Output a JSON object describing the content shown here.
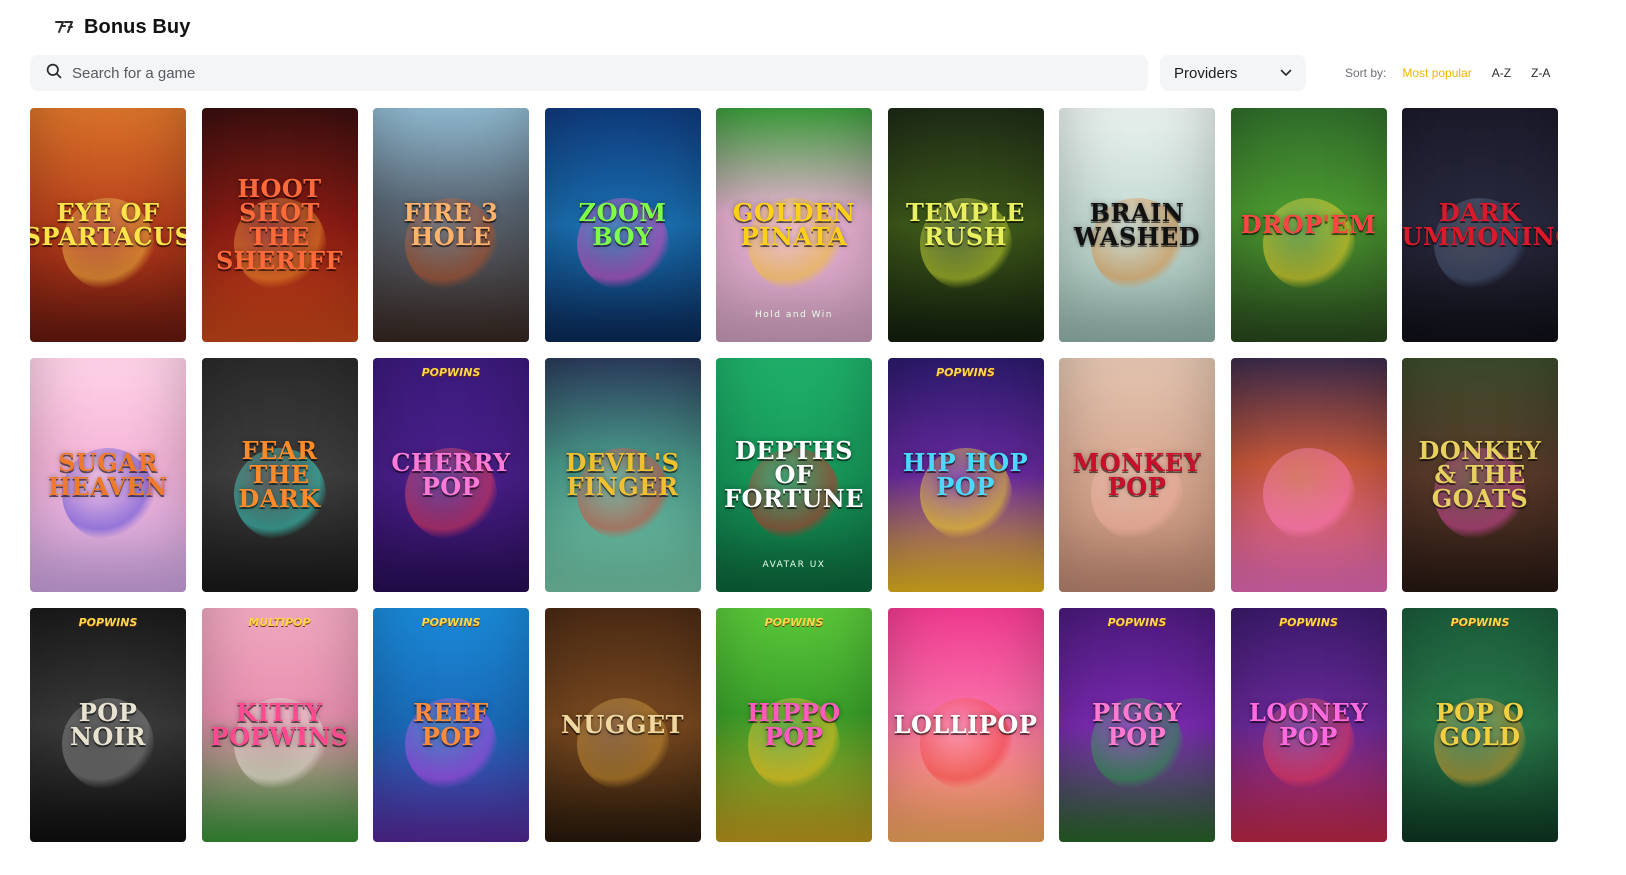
{
  "header": {
    "title": "Bonus Buy",
    "logo_icon": "logo-7-icon"
  },
  "search": {
    "placeholder": "Search for a game"
  },
  "providers": {
    "label": "Providers"
  },
  "sort": {
    "label": "Sort by:",
    "options": [
      "Most popular",
      "A-Z",
      "Z-A"
    ],
    "active": "Most popular",
    "active_color": "#f0b400"
  },
  "games": [
    {
      "slug": "eye-of-spartacus",
      "title": "Eye of Spartacus",
      "bg": "linear-gradient(180deg,#d9732a 0%,#b3391a 55%,#6b1a10 100%)",
      "fg": "#ffe34a",
      "art": "#f2b640"
    },
    {
      "slug": "hoot-shot-the-sheriff",
      "title": "Hoot Shot The Sheriff",
      "bg": "linear-gradient(180deg,#3a0f0f 0%,#8e1c14 50%,#d24a1a 100%)",
      "fg": "#ff6a3a",
      "art": "#e88a2a"
    },
    {
      "slug": "fire-3-hole",
      "title": "Fire 3 Hole",
      "bg": "linear-gradient(180deg,#8fb8cf 0%,#5c6a78 40%,#3a2a24 100%)",
      "fg": "#ffb36a",
      "art": "#b5532a"
    },
    {
      "slug": "zoom-boy",
      "title": "Zoom Boy",
      "bg": "linear-gradient(180deg,#0f3a7a 0%,#1a6fb0 50%,#0b2a5a 100%)",
      "fg": "#7dff4a",
      "art": "#e84ac0"
    },
    {
      "slug": "golden-pinata",
      "title": "Golden Pinata",
      "sub": "Hold and Win",
      "bg": "linear-gradient(180deg,#3a9a3a 0%,#e6b0d0 45%,#d9a8c8 100%)",
      "fg": "#ffcf1a",
      "art": "#f3c02a"
    },
    {
      "slug": "temple-rush",
      "title": "Temple Rush",
      "bg": "linear-gradient(180deg,#1d2a16 0%,#3e5a1a 50%,#14200e 100%)",
      "fg": "#e8f060",
      "art": "#c8d830"
    },
    {
      "slug": "brain-washed",
      "title": "Brain Washed",
      "bg": "linear-gradient(180deg,#e9f1ee 0%,#c3d9d2 50%,#9cc0b6 100%)",
      "fg": "#111111",
      "art": "#d88a3a"
    },
    {
      "slug": "drop-em",
      "title": "Drop'Em",
      "bg": "linear-gradient(180deg,#2f6b2a 0%,#4c9a30 45%,#2a4a1f 100%)",
      "fg": "#ff4444",
      "art": "#f3d22a"
    },
    {
      "slug": "dark-summoning",
      "title": "Dark Summoning",
      "bg": "linear-gradient(180deg,#1a1a2a 0%,#2a2a40 50%,#101018 100%)",
      "fg": "#d81a2a",
      "art": "#4a5a7a"
    },
    {
      "slug": "sugar-heaven",
      "title": "Sugar Heaven",
      "bg": "linear-gradient(180deg,#ffd3e8 0%,#f5b5d8 45%,#d9b0f0 100%)",
      "fg": "#f07a2a",
      "art": "#5a4ad8"
    },
    {
      "slug": "fear-the-dark",
      "title": "Fear The Dark",
      "bg": "linear-gradient(180deg,#2a2a2a 0%,#3f3f3f 50%,#1a1a1a 100%)",
      "fg": "#ff8a2a",
      "art": "#3ad8c8"
    },
    {
      "slug": "cherry-pop",
      "title": "Cherry Pop",
      "brand": "POPWINS",
      "bg": "linear-gradient(180deg,#3a1a7a 0%,#4a1f8a 50%,#2a0f5a 100%)",
      "fg": "#ff7ad8",
      "art": "#e83a5a"
    },
    {
      "slug": "devils-finger",
      "title": "Devil's Finger",
      "bg": "linear-gradient(180deg,#2a3a5a 0%,#4a9a8a 45%,#7ad0b0 100%)",
      "fg": "#f0c030",
      "art": "#d84a3a"
    },
    {
      "slug": "depths-of-fortune",
      "title": "Depths of Fortune",
      "sub": "AVATAR UX",
      "bg": "linear-gradient(180deg,#1fb06a 0%,#17985a 50%,#0d6a3e 100%)",
      "fg": "#ffffff",
      "art": "#c8302a"
    },
    {
      "slug": "hip-hop-pop",
      "title": "Hip Hop Pop",
      "brand": "POPWINS",
      "bg": "linear-gradient(180deg,#2a1a6a 0%,#6a2aa0 50%,#f0c020 100%)",
      "fg": "#4ad8ff",
      "art": "#f0d02a"
    },
    {
      "slug": "monkey-pop",
      "title": "Monkey Pop",
      "bg": "linear-gradient(180deg,#e2c4b0 0%,#d8a890 50%,#c89078 100%)",
      "fg": "#c8102a",
      "art": "#f0b0a0"
    },
    {
      "slug": "tiger",
      "title": "",
      "bg": "linear-gradient(180deg,#3a2a4a 0%,#c8583a 45%,#f070c0 100%)",
      "fg": "#ffffff",
      "art": "#ff7ab8"
    },
    {
      "slug": "donkey-and-the-goats",
      "title": "Donkey & The Goats",
      "bg": "linear-gradient(180deg,#3a4a2a 0%,#5a3a2a 50%,#2a1a14 100%)",
      "fg": "#e8d060",
      "art": "#d84aa0"
    },
    {
      "slug": "pop-noir",
      "title": "Pop Noir",
      "brand": "POPWINS",
      "bg": "linear-gradient(180deg,#1a1a1a 0%,#3a3a3a 50%,#0f0f0f 100%)",
      "fg": "#e8e2d0",
      "art": "#888888"
    },
    {
      "slug": "kitty-popwins",
      "title": "Kitty Popwins",
      "brand": "MULTIPOP",
      "bg": "linear-gradient(180deg,#f0a8c0 0%,#e890b0 45%,#3a9a3a 100%)",
      "fg": "#ff4a90",
      "art": "#e8e0d8"
    },
    {
      "slug": "reef-pop",
      "title": "Reef Pop",
      "brand": "POPWINS",
      "bg": "linear-gradient(180deg,#1a8ad8 0%,#1a6ab8 50%,#5a2aa0 100%)",
      "fg": "#ff8a3a",
      "art": "#b84ae8"
    },
    {
      "slug": "nugget",
      "title": "Nugget",
      "bg": "linear-gradient(180deg,#4a2a14 0%,#7a4a20 50%,#2a1a0c 100%)",
      "fg": "#f0d8a0",
      "art": "#c89030"
    },
    {
      "slug": "hippo-pop",
      "title": "Hippo Pop",
      "brand": "POPWINS",
      "bg": "linear-gradient(180deg,#5ac83a 0%,#3aa02a 45%,#c8a020 100%)",
      "fg": "#ff5ac0",
      "art": "#f0c020"
    },
    {
      "slug": "lollipop",
      "title": "Lollipop",
      "bg": "linear-gradient(180deg,#f03a90 0%,#f870a8 45%,#ffb060 100%)",
      "fg": "#ffffff",
      "art": "#f04040"
    },
    {
      "slug": "piggy-pop",
      "title": "Piggy Pop",
      "brand": "POPWINS",
      "bg": "linear-gradient(180deg,#4a1a7a 0%,#7a2ab0 50%,#2a6a2a 100%)",
      "fg": "#ff7ad0",
      "art": "#2a9a4a"
    },
    {
      "slug": "looney-pop",
      "title": "Looney Pop",
      "brand": "POPWINS",
      "bg": "linear-gradient(180deg,#3a1a6a 0%,#6a2a9a 50%,#c82a4a 100%)",
      "fg": "#ff6ae0",
      "art": "#e83a5a"
    },
    {
      "slug": "pop-o-gold",
      "title": "Pop O Gold",
      "brand": "POPWINS",
      "bg": "linear-gradient(180deg,#1a5a3a 0%,#2a7a4a 50%,#0f3a24 100%)",
      "fg": "#f0d040",
      "art": "#d8a030"
    }
  ]
}
